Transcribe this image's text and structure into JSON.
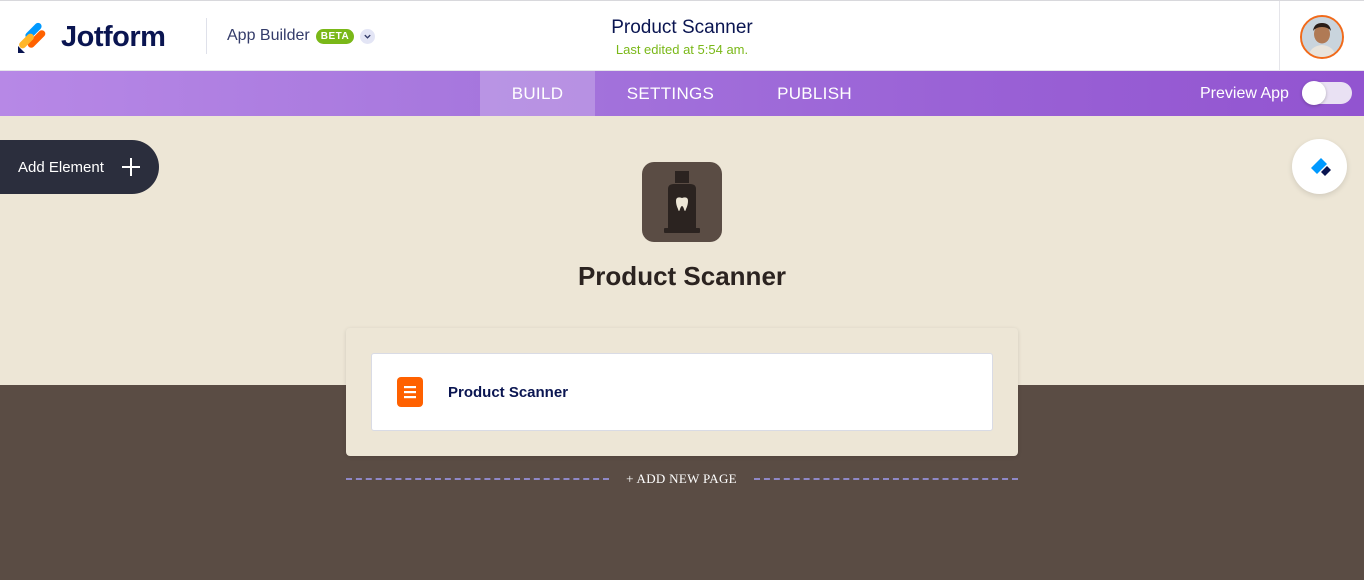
{
  "brand": {
    "name": "Jotform"
  },
  "app_builder": {
    "label": "App Builder",
    "badge": "BETA"
  },
  "document": {
    "title": "Product Scanner",
    "status": "Last edited at 5:54 am."
  },
  "nav": {
    "tabs": [
      {
        "label": "BUILD",
        "active": true
      },
      {
        "label": "SETTINGS",
        "active": false
      },
      {
        "label": "PUBLISH",
        "active": false
      }
    ],
    "preview_label": "Preview App",
    "preview_enabled": false
  },
  "sidebar": {
    "add_element_label": "Add Element"
  },
  "app": {
    "title": "Product Scanner",
    "icon": "bottle-icon"
  },
  "pages": [
    {
      "label": "Product Scanner",
      "icon": "form-page-icon"
    }
  ],
  "add_page_label": "+ ADD NEW PAGE",
  "colors": {
    "brand_navy": "#0a1551",
    "accent_green": "#7ab818",
    "nav_purple": "#9a62d6",
    "canvas_beige": "#ede6d6",
    "canvas_brown": "#5a4c44",
    "page_icon_orange": "#ff6100"
  }
}
